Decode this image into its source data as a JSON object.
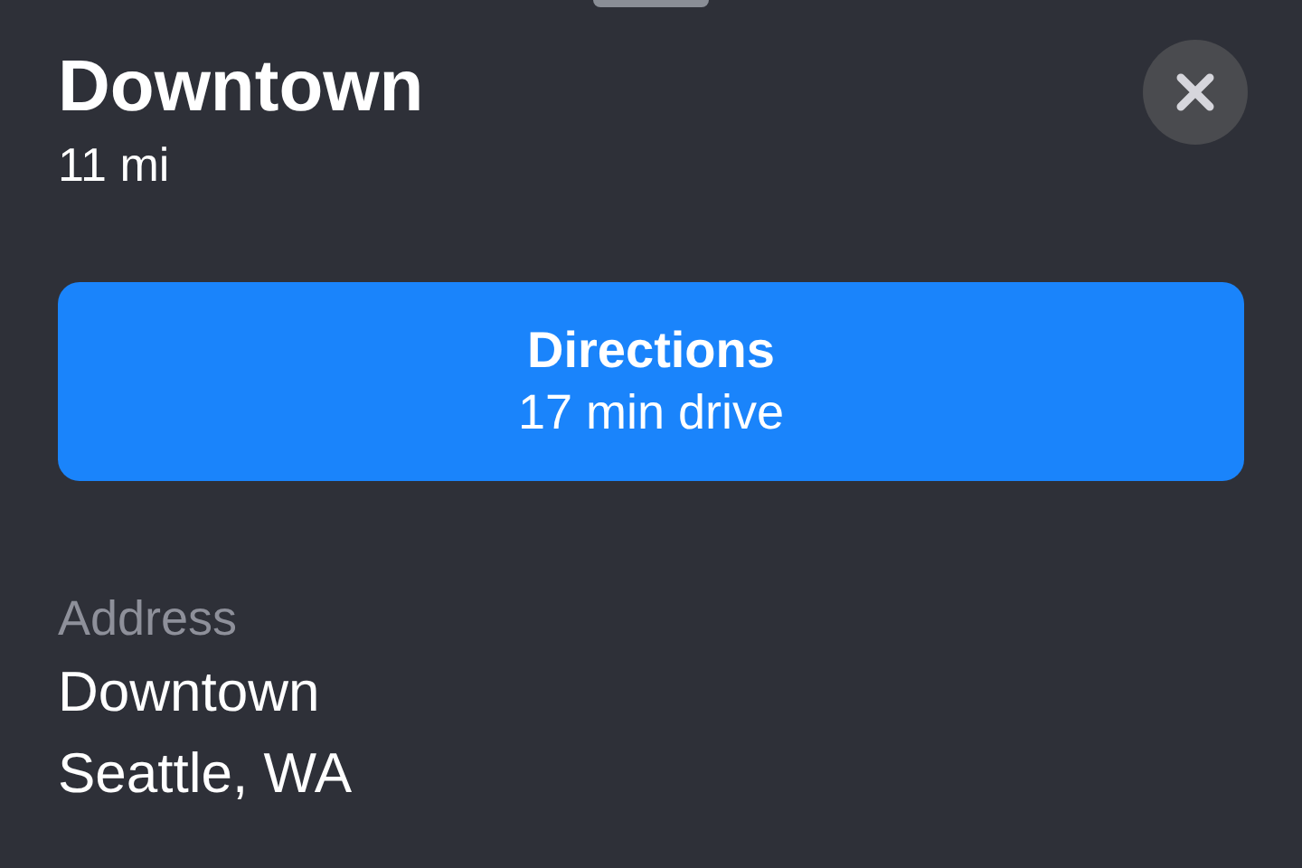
{
  "place": {
    "title": "Downtown",
    "distance": "11 mi"
  },
  "directions_button": {
    "label": "Directions",
    "detail": "17 min drive"
  },
  "address": {
    "label": "Address",
    "lines": [
      "Downtown",
      "Seattle, WA"
    ]
  }
}
